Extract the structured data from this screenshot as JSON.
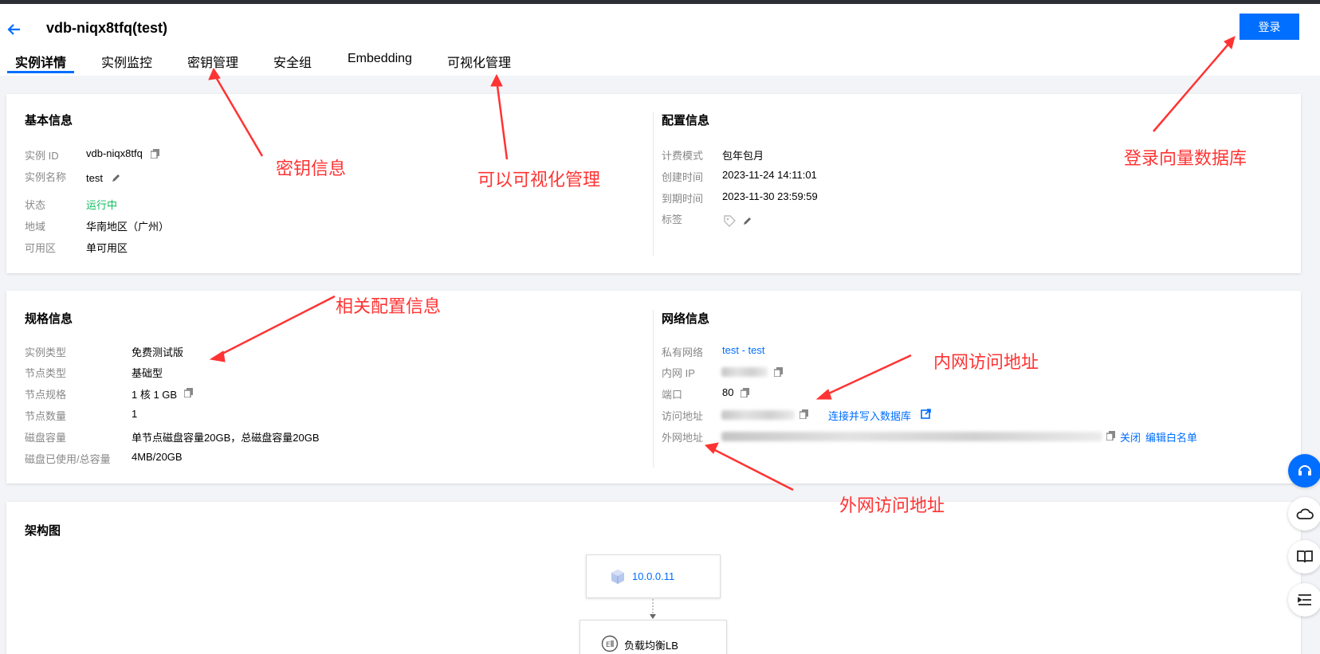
{
  "header": {
    "title": "vdb-niqx8tfq(test)",
    "login_label": "登录"
  },
  "tabs": [
    "实例详情",
    "实例监控",
    "密钥管理",
    "安全组",
    "Embedding",
    "可视化管理"
  ],
  "basic": {
    "title": "基本信息",
    "rows": [
      {
        "label": "实例 ID",
        "value": "vdb-niqx8tfq"
      },
      {
        "label": "实例名称",
        "value": "test"
      },
      {
        "label": "状态",
        "value": "运行中"
      },
      {
        "label": "地域",
        "value": "华南地区（广州）"
      },
      {
        "label": "可用区",
        "value": "单可用区"
      }
    ]
  },
  "config": {
    "title": "配置信息",
    "rows": [
      {
        "label": "计费模式",
        "value": "包年包月"
      },
      {
        "label": "创建时间",
        "value": "2023-11-24 14:11:01"
      },
      {
        "label": "到期时间",
        "value": "2023-11-30 23:59:59"
      },
      {
        "label": "标签",
        "value": ""
      }
    ]
  },
  "spec": {
    "title": "规格信息",
    "rows": [
      {
        "label": "实例类型",
        "value": "免费测试版"
      },
      {
        "label": "节点类型",
        "value": "基础型"
      },
      {
        "label": "节点规格",
        "value": "1 核 1 GB"
      },
      {
        "label": "节点数量",
        "value": "1"
      },
      {
        "label": "磁盘容量",
        "value": "单节点磁盘容量20GB，总磁盘容量20GB"
      },
      {
        "label": "磁盘已使用/总容量",
        "value": "4MB/20GB"
      }
    ]
  },
  "network": {
    "title": "网络信息",
    "rows": [
      {
        "label": "私有网络",
        "value": "test - test"
      },
      {
        "label": "内网 IP",
        "value": ""
      },
      {
        "label": "端口",
        "value": "80"
      },
      {
        "label": "访问地址",
        "value": ""
      },
      {
        "label": "外网地址",
        "value": ""
      }
    ],
    "connect_link": "连接并写入数据库",
    "close_link": "关闭",
    "whitelist_link": "编辑白名单"
  },
  "arch": {
    "title": "架构图",
    "node1": "10.0.0.11",
    "node2": "负载均衡LB"
  },
  "annotations": {
    "key_info": "密钥信息",
    "visual": "可以可视化管理",
    "login_db": "登录向量数据库",
    "config_info": "相关配置信息",
    "intranet": "内网访问地址",
    "extranet": "外网访问地址"
  },
  "colors": {
    "accent": "#006eff",
    "annotation": "#ff3333",
    "status_running": "#0abf5b"
  }
}
